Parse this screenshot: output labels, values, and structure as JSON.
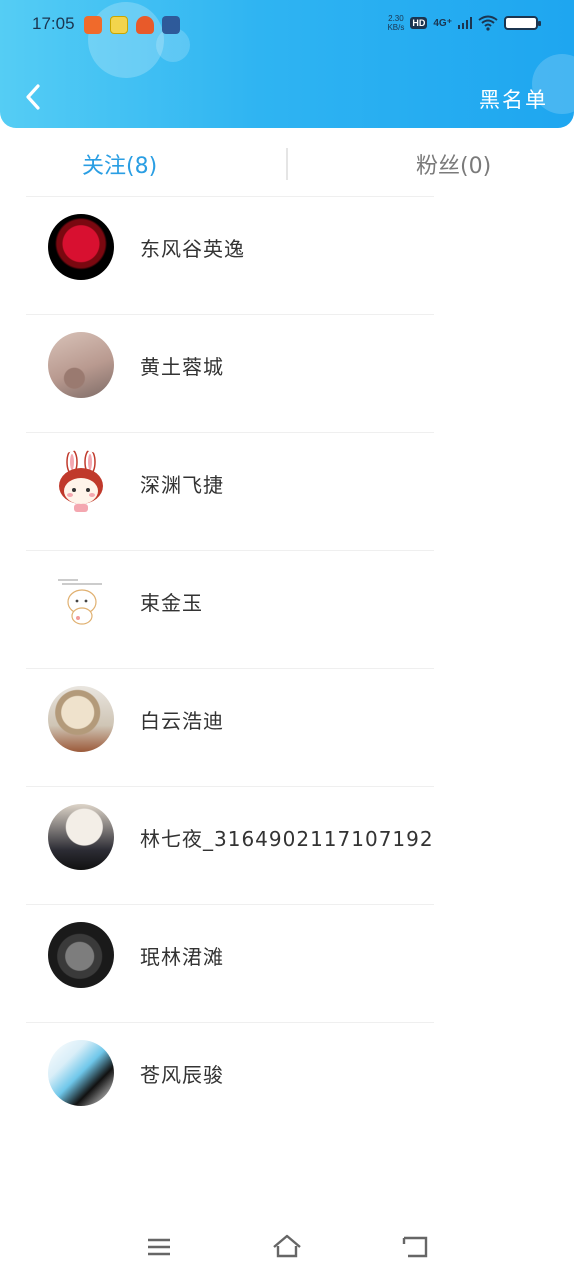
{
  "status_bar": {
    "time": "17:05",
    "net_speed": "2.30",
    "net_unit": "KB/s",
    "hd": "HD",
    "signal": "4G⁺"
  },
  "header": {
    "back_icon": "chevron-left-icon",
    "blacklist_label": "黑名单",
    "bg_color": "#2fb4f2"
  },
  "tabs": {
    "following": "关注(8)",
    "fans": "粉丝(0)",
    "active_color": "#2a9ee3"
  },
  "users": [
    {
      "name": "东风谷英逸"
    },
    {
      "name": "黄土蓉城"
    },
    {
      "name": "深渊飞捷"
    },
    {
      "name": "束金玉"
    },
    {
      "name": "白云浩迪"
    },
    {
      "name": "林七夜_3164902117107192"
    },
    {
      "name": "珉林涒滩"
    },
    {
      "name": "苍风辰骏"
    }
  ],
  "nav": {
    "menu_icon": "menu-icon",
    "home_icon": "home-icon",
    "back_icon": "back-icon"
  }
}
